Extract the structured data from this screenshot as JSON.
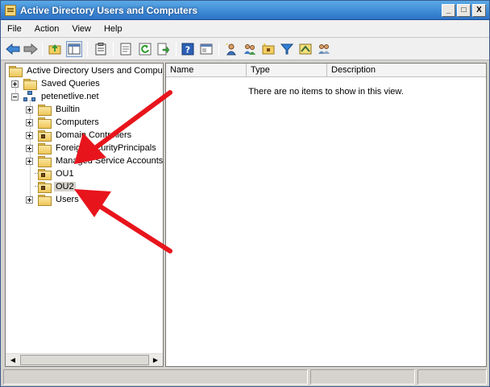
{
  "window": {
    "title": "Active Directory Users and Computers",
    "controls": [
      "_",
      "□",
      "X"
    ]
  },
  "menu": [
    "File",
    "Action",
    "View",
    "Help"
  ],
  "toolbar": {
    "icons": [
      "back-icon",
      "forward-icon",
      "up-level-icon",
      "show-hide-tree-icon",
      "clipboard-icon",
      "properties-icon",
      "refresh-icon",
      "export-icon",
      "help-icon",
      "console-icon",
      "new-user-icon",
      "new-group-icon",
      "new-ou-icon",
      "filter-icon",
      "delegate-icon",
      "add-to-group-icon"
    ]
  },
  "tree": {
    "root": "Active Directory Users and Comput",
    "saved_queries": "Saved Queries",
    "domain": "petenetlive.net",
    "children": [
      {
        "label": "Builtin",
        "type": "folder",
        "expandable": true
      },
      {
        "label": "Computers",
        "type": "folder",
        "expandable": true
      },
      {
        "label": "Domain Controllers",
        "type": "ou",
        "expandable": true
      },
      {
        "label": "ForeignSecurityPrincipals",
        "type": "folder",
        "expandable": true
      },
      {
        "label": "Managed Service Accounts",
        "type": "folder",
        "expandable": true
      },
      {
        "label": "OU1",
        "type": "ou",
        "expandable": false
      },
      {
        "label": "OU2",
        "type": "ou",
        "expandable": false,
        "selected": true
      },
      {
        "label": "Users",
        "type": "folder",
        "expandable": true
      }
    ]
  },
  "list": {
    "columns": [
      "Name",
      "Type",
      "Description"
    ],
    "empty_message": "There are no items to show in this view."
  },
  "colors": {
    "arrow": "#e8141c",
    "titlebar": "#2c73c8"
  }
}
